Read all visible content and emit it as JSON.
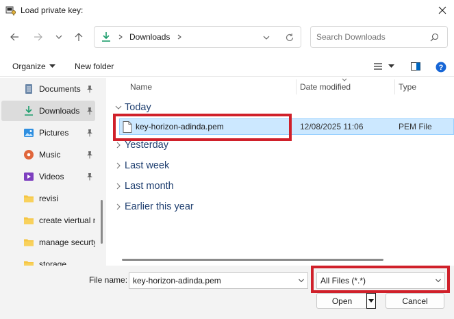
{
  "window": {
    "title": "Load private key:"
  },
  "nav": {
    "address": {
      "location": "Downloads"
    },
    "search": {
      "placeholder": "Search Downloads"
    }
  },
  "toolbar": {
    "organize_label": "Organize",
    "new_folder_label": "New folder"
  },
  "sidebar": {
    "items": [
      {
        "label": "Documents",
        "icon": "document-icon",
        "pinned": true
      },
      {
        "label": "Downloads",
        "icon": "download-icon",
        "pinned": true,
        "selected": true
      },
      {
        "label": "Pictures",
        "icon": "picture-icon",
        "pinned": true
      },
      {
        "label": "Music",
        "icon": "music-icon",
        "pinned": true
      },
      {
        "label": "Videos",
        "icon": "video-icon",
        "pinned": true
      },
      {
        "label": "revisi",
        "icon": "folder-icon"
      },
      {
        "label": "create viertual m",
        "icon": "folder-icon"
      },
      {
        "label": "manage securty",
        "icon": "folder-icon"
      },
      {
        "label": "storage",
        "icon": "folder-icon"
      }
    ]
  },
  "list": {
    "columns": {
      "name": "Name",
      "date": "Date modified",
      "type": "Type"
    },
    "groups": {
      "today": "Today",
      "yesterday": "Yesterday",
      "last_week": "Last week",
      "last_month": "Last month",
      "earlier": "Earlier this year"
    },
    "files": [
      {
        "name": "key-horizon-adinda.pem",
        "date": "12/08/2025 11:06",
        "type": "PEM File",
        "selected": true
      }
    ]
  },
  "footer": {
    "file_name_label": "File name:",
    "file_name_value": "key-horizon-adinda.pem",
    "file_type_value": "All Files (*.*)",
    "open_label": "Open",
    "cancel_label": "Cancel"
  },
  "colors": {
    "selection": "#cce8ff",
    "highlight_box": "#d0202a",
    "group_heading": "#1e3e6f",
    "sidebar_bg": "#f3f3f3"
  }
}
